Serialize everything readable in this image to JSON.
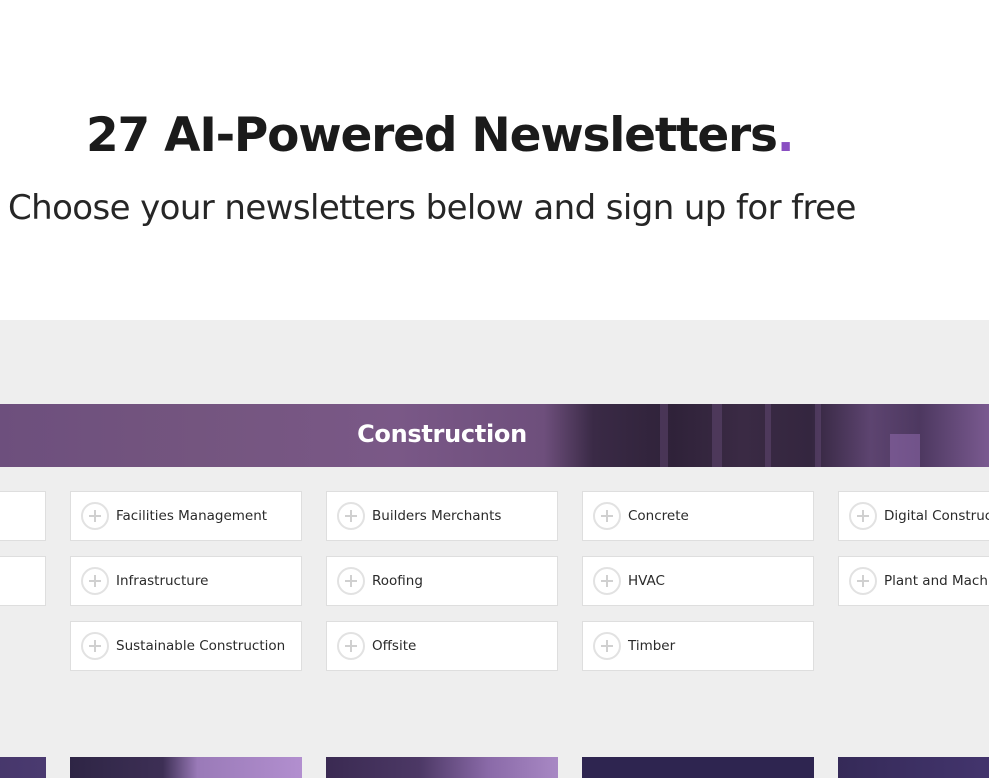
{
  "hero": {
    "title": "27 AI-Powered Newsletters",
    "title_dot": ".",
    "subtitle": "Choose your newsletters below and sign up for free"
  },
  "colors": {
    "accent": "#8a4fc2",
    "banner": "#6d4f7d",
    "section_bg": "#eeeeee"
  },
  "category": {
    "title": "Construction",
    "columns": [
      {
        "items": [
          {
            "label": ""
          },
          {
            "label": ""
          }
        ]
      },
      {
        "items": [
          {
            "label": "Facilities Management"
          },
          {
            "label": "Infrastructure"
          },
          {
            "label": "Sustainable Construction"
          }
        ]
      },
      {
        "items": [
          {
            "label": "Builders Merchants"
          },
          {
            "label": "Roofing"
          },
          {
            "label": "Offsite"
          }
        ]
      },
      {
        "items": [
          {
            "label": "Concrete"
          },
          {
            "label": "HVAC"
          },
          {
            "label": "Timber"
          }
        ]
      },
      {
        "items": [
          {
            "label": "Digital Construction"
          },
          {
            "label": "Plant and Machinery"
          }
        ]
      }
    ],
    "item_icon": "plus-circle-icon"
  }
}
